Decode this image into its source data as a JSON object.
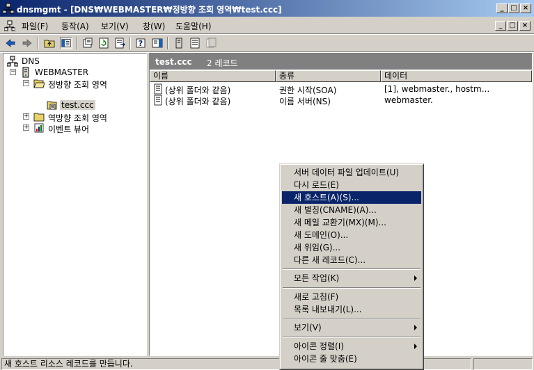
{
  "window": {
    "title": "dnsmgmt - [DNS₩WEBMASTER₩정방향 조회 영역₩test.ccc]",
    "minimize_glyph": "_",
    "maximize_glyph": "□",
    "close_glyph": "×"
  },
  "menubar": {
    "items": [
      "파일(F)",
      "동작(A)",
      "보기(V)",
      "창(W)",
      "도움말(H)"
    ]
  },
  "toolbar": {
    "buttons": [
      "back-icon",
      "forward-icon",
      "up-folder-icon",
      "show-hide-tree-icon",
      "properties-icon",
      "refresh-icon",
      "export-list-icon",
      "help-icon",
      "action-pane-icon",
      "new-server-icon",
      "new-zone-icon",
      "new-record-icon"
    ]
  },
  "tree": {
    "items": [
      {
        "label": "DNS",
        "icon": "dns-icon"
      },
      {
        "label": "WEBMASTER",
        "icon": "server-icon",
        "expander": "−"
      },
      {
        "label": "정방향 조회 영역",
        "icon": "folder-open-icon",
        "expander": "−"
      },
      {
        "label": "test.ccc",
        "icon": "zone-icon",
        "selected": true
      },
      {
        "label": "역방향 조회 영역",
        "icon": "folder-icon",
        "expander": "+"
      },
      {
        "label": "이벤트 뷰어",
        "icon": "event-viewer-icon",
        "expander": "+"
      }
    ]
  },
  "details": {
    "zone_name": "test.ccc",
    "record_count": "2 레코드",
    "columns": [
      "이름",
      "종류",
      "데이터"
    ],
    "rows": [
      {
        "name": "(상위 폴더와 같음)",
        "type": "권한 시작(SOA)",
        "data": "[1], webmaster., hostm..."
      },
      {
        "name": "(상위 폴더와 같음)",
        "type": "이름 서버(NS)",
        "data": "webmaster."
      }
    ]
  },
  "context_menu": {
    "items": [
      {
        "label": "서버 데이터 파일 업데이트(U)"
      },
      {
        "label": "다시 로드(E)"
      },
      {
        "label": "새 호스트(A)(S)...",
        "highlighted": true
      },
      {
        "label": "새 별칭(CNAME)(A)..."
      },
      {
        "label": "새 메일 교환기(MX)(M)..."
      },
      {
        "label": "새 도메인(O)..."
      },
      {
        "label": "새 위임(G)..."
      },
      {
        "label": "다른 새 레코드(C)..."
      },
      {
        "label": "모든 작업(K)",
        "submenu": true
      },
      {
        "label": "새로 고침(F)"
      },
      {
        "label": "목록 내보내기(L)..."
      },
      {
        "label": "보기(V)",
        "submenu": true
      },
      {
        "label": "아이콘 정렬(I)",
        "submenu": true
      },
      {
        "label": "아이콘 줄 맞춤(E)"
      }
    ]
  },
  "statusbar": {
    "message": "새 호스트 리소스 레코드를 만듭니다."
  },
  "colors": {
    "title_active": "#0a246a",
    "face": "#d4d0c8",
    "highlight": "#0a246a",
    "pane_header": "#808080"
  }
}
